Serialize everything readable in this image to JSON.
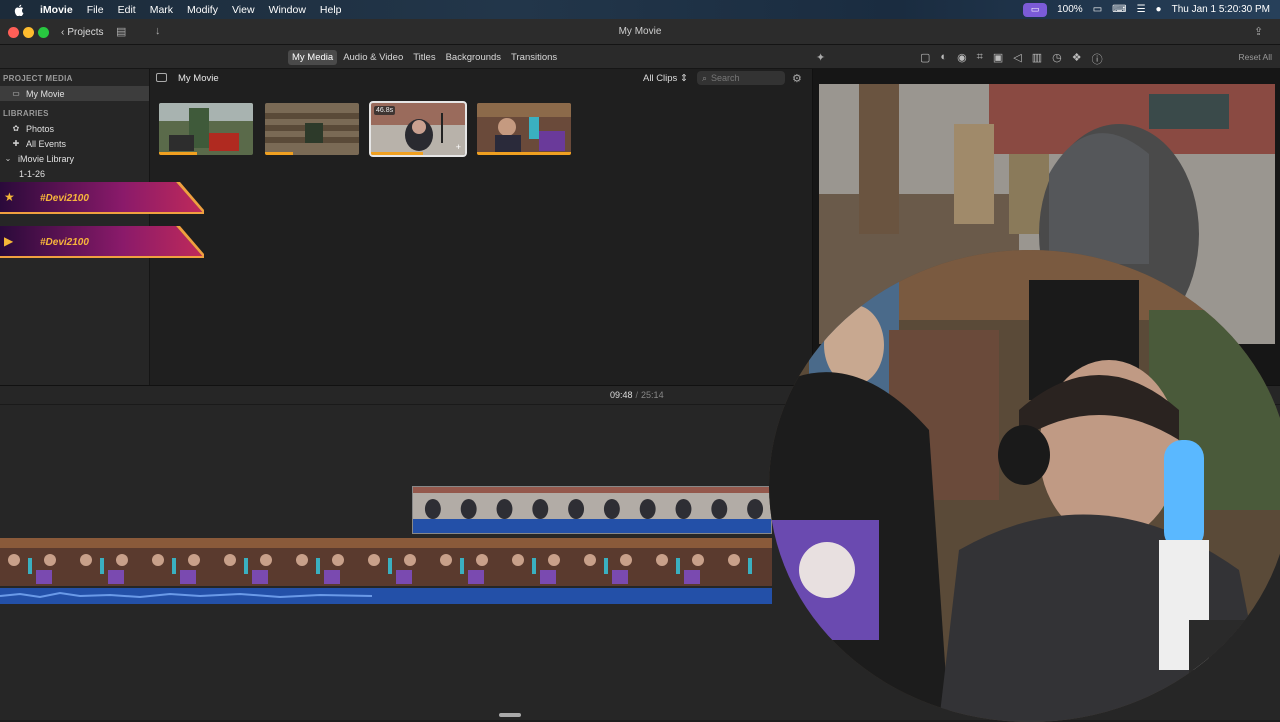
{
  "menubar": {
    "app": "iMovie",
    "items": [
      "File",
      "Edit",
      "Mark",
      "Modify",
      "View",
      "Window",
      "Help"
    ],
    "battery": "100%",
    "clock": "Thu Jan 1  5:20:30 PM"
  },
  "window": {
    "title": "My Movie",
    "projects_label": "Projects"
  },
  "toolbar": {
    "tabs": [
      "My Media",
      "Audio & Video",
      "Titles",
      "Backgrounds",
      "Transitions"
    ],
    "active_tab": "My Media",
    "reset_all": "Reset All"
  },
  "sidebar": {
    "project_media_header": "PROJECT MEDIA",
    "project": "My Movie",
    "libraries_header": "LIBRARIES",
    "photos": "Photos",
    "all_events": "All Events",
    "library": "iMovie Library",
    "event": "1-1-26"
  },
  "browser": {
    "title": "My Movie",
    "filter": "All Clips",
    "search_placeholder": "Search",
    "selected_clip_duration": "46.8s"
  },
  "overlay": {
    "twitch_name_1": "#Devi2100",
    "twitch_name_2": "#Devi2100"
  },
  "timeline": {
    "current": "09:48",
    "separator": "/",
    "total": "25:14"
  },
  "colors": {
    "accent_audio": "#2350a8",
    "clip_bar": "#f0a020",
    "selection": "#e6e6e6"
  }
}
